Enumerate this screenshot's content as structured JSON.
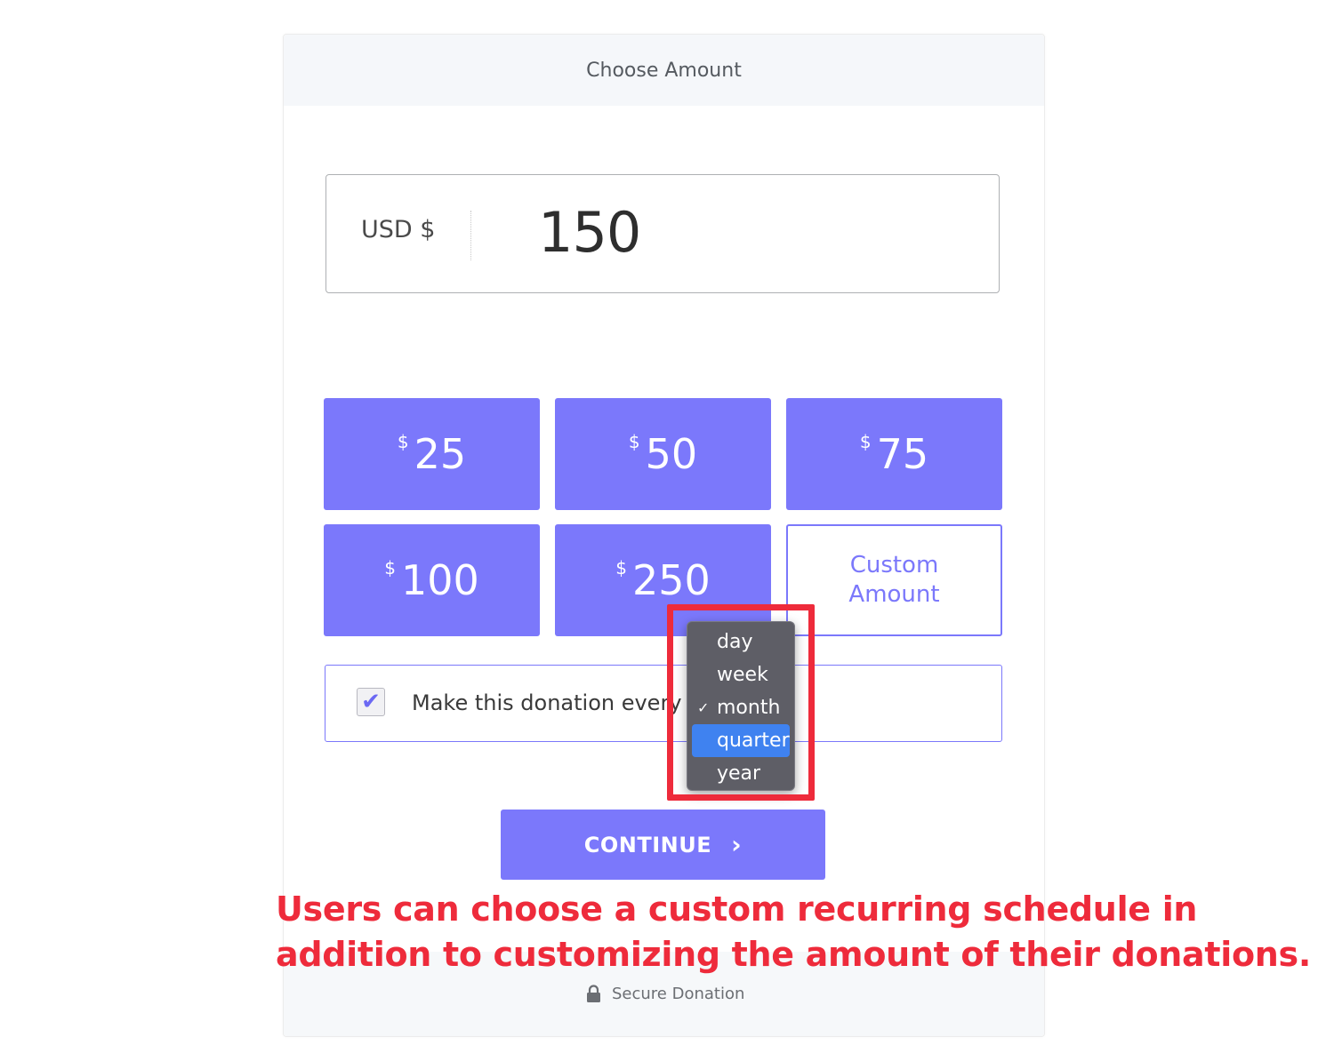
{
  "header": {
    "title": "Choose Amount"
  },
  "amount": {
    "currency_label": "USD $",
    "value": "150"
  },
  "presets": [
    {
      "symbol": "$",
      "amount": "25"
    },
    {
      "symbol": "$",
      "amount": "50"
    },
    {
      "symbol": "$",
      "amount": "75"
    },
    {
      "symbol": "$",
      "amount": "100"
    },
    {
      "symbol": "$",
      "amount": "250"
    }
  ],
  "custom": {
    "line1": "Custom",
    "line2": "Amount"
  },
  "recurring": {
    "checked": true,
    "checkmark": "✔",
    "label": "Make this donation every",
    "options": [
      "day",
      "week",
      "month",
      "quarter",
      "year"
    ],
    "selected": "month",
    "highlighted": "quarter",
    "check_glyph": "✓"
  },
  "continue": {
    "label": "CONTINUE",
    "chevron": "›"
  },
  "annotation": {
    "text": "Users can choose a custom recurring schedule in addition to customizing the amount of their donations."
  },
  "footer": {
    "secure_label": "Secure Donation",
    "icon": "lock-icon"
  },
  "colors": {
    "accent": "#7b78fb",
    "annotation_red": "#ee2b3b",
    "highlight_blue": "#3f82f0"
  }
}
